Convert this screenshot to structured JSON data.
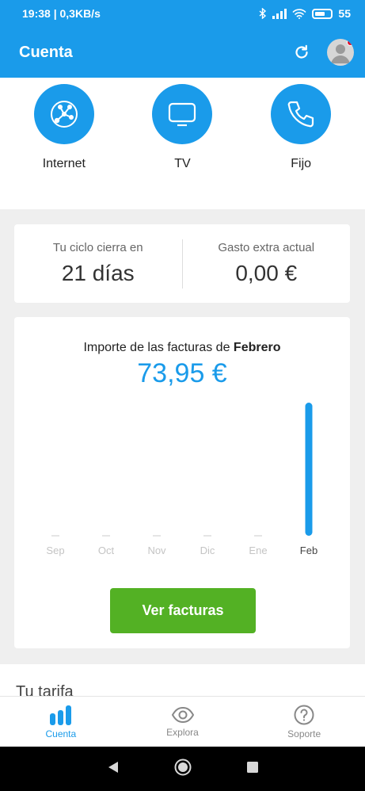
{
  "status_bar": {
    "time_speed": "19:38 | 0,3KB/s",
    "battery_level": "55"
  },
  "app_bar": {
    "title": "Cuenta"
  },
  "services": [
    {
      "label": "Internet",
      "icon": "network-icon"
    },
    {
      "label": "TV",
      "icon": "tv-icon"
    },
    {
      "label": "Fijo",
      "icon": "phone-icon"
    }
  ],
  "cycle": {
    "closes_label": "Tu ciclo cierra en",
    "closes_value": "21 días",
    "extra_label": "Gasto extra actual",
    "extra_value": "0,00 €"
  },
  "bills": {
    "heading_prefix": "Importe de las facturas de",
    "heading_month": "Febrero",
    "amount": "73,95 €",
    "button_label": "Ver facturas"
  },
  "chart_data": {
    "type": "bar",
    "categories": [
      "Sep",
      "Oct",
      "Nov",
      "Dic",
      "Ene",
      "Feb"
    ],
    "values": [
      0,
      0,
      0,
      0,
      0,
      73.95
    ],
    "highlighted_category": "Feb",
    "ylim": [
      0,
      73.95
    ],
    "grid": false,
    "colors": {
      "active": "#1a9bea",
      "inactive_label": "#c4c4c4",
      "active_label": "#444444"
    }
  },
  "tarifa": {
    "label": "Tu tarifa"
  },
  "bottom_nav": [
    {
      "label": "Cuenta",
      "icon": "bar-chart-icon",
      "active": true
    },
    {
      "label": "Explora",
      "icon": "eye-icon",
      "active": false
    },
    {
      "label": "Soporte",
      "icon": "help-icon",
      "active": false
    }
  ],
  "colors": {
    "brand": "#1a9bea",
    "accent_button": "#53b124",
    "notification": "#e0132b"
  }
}
